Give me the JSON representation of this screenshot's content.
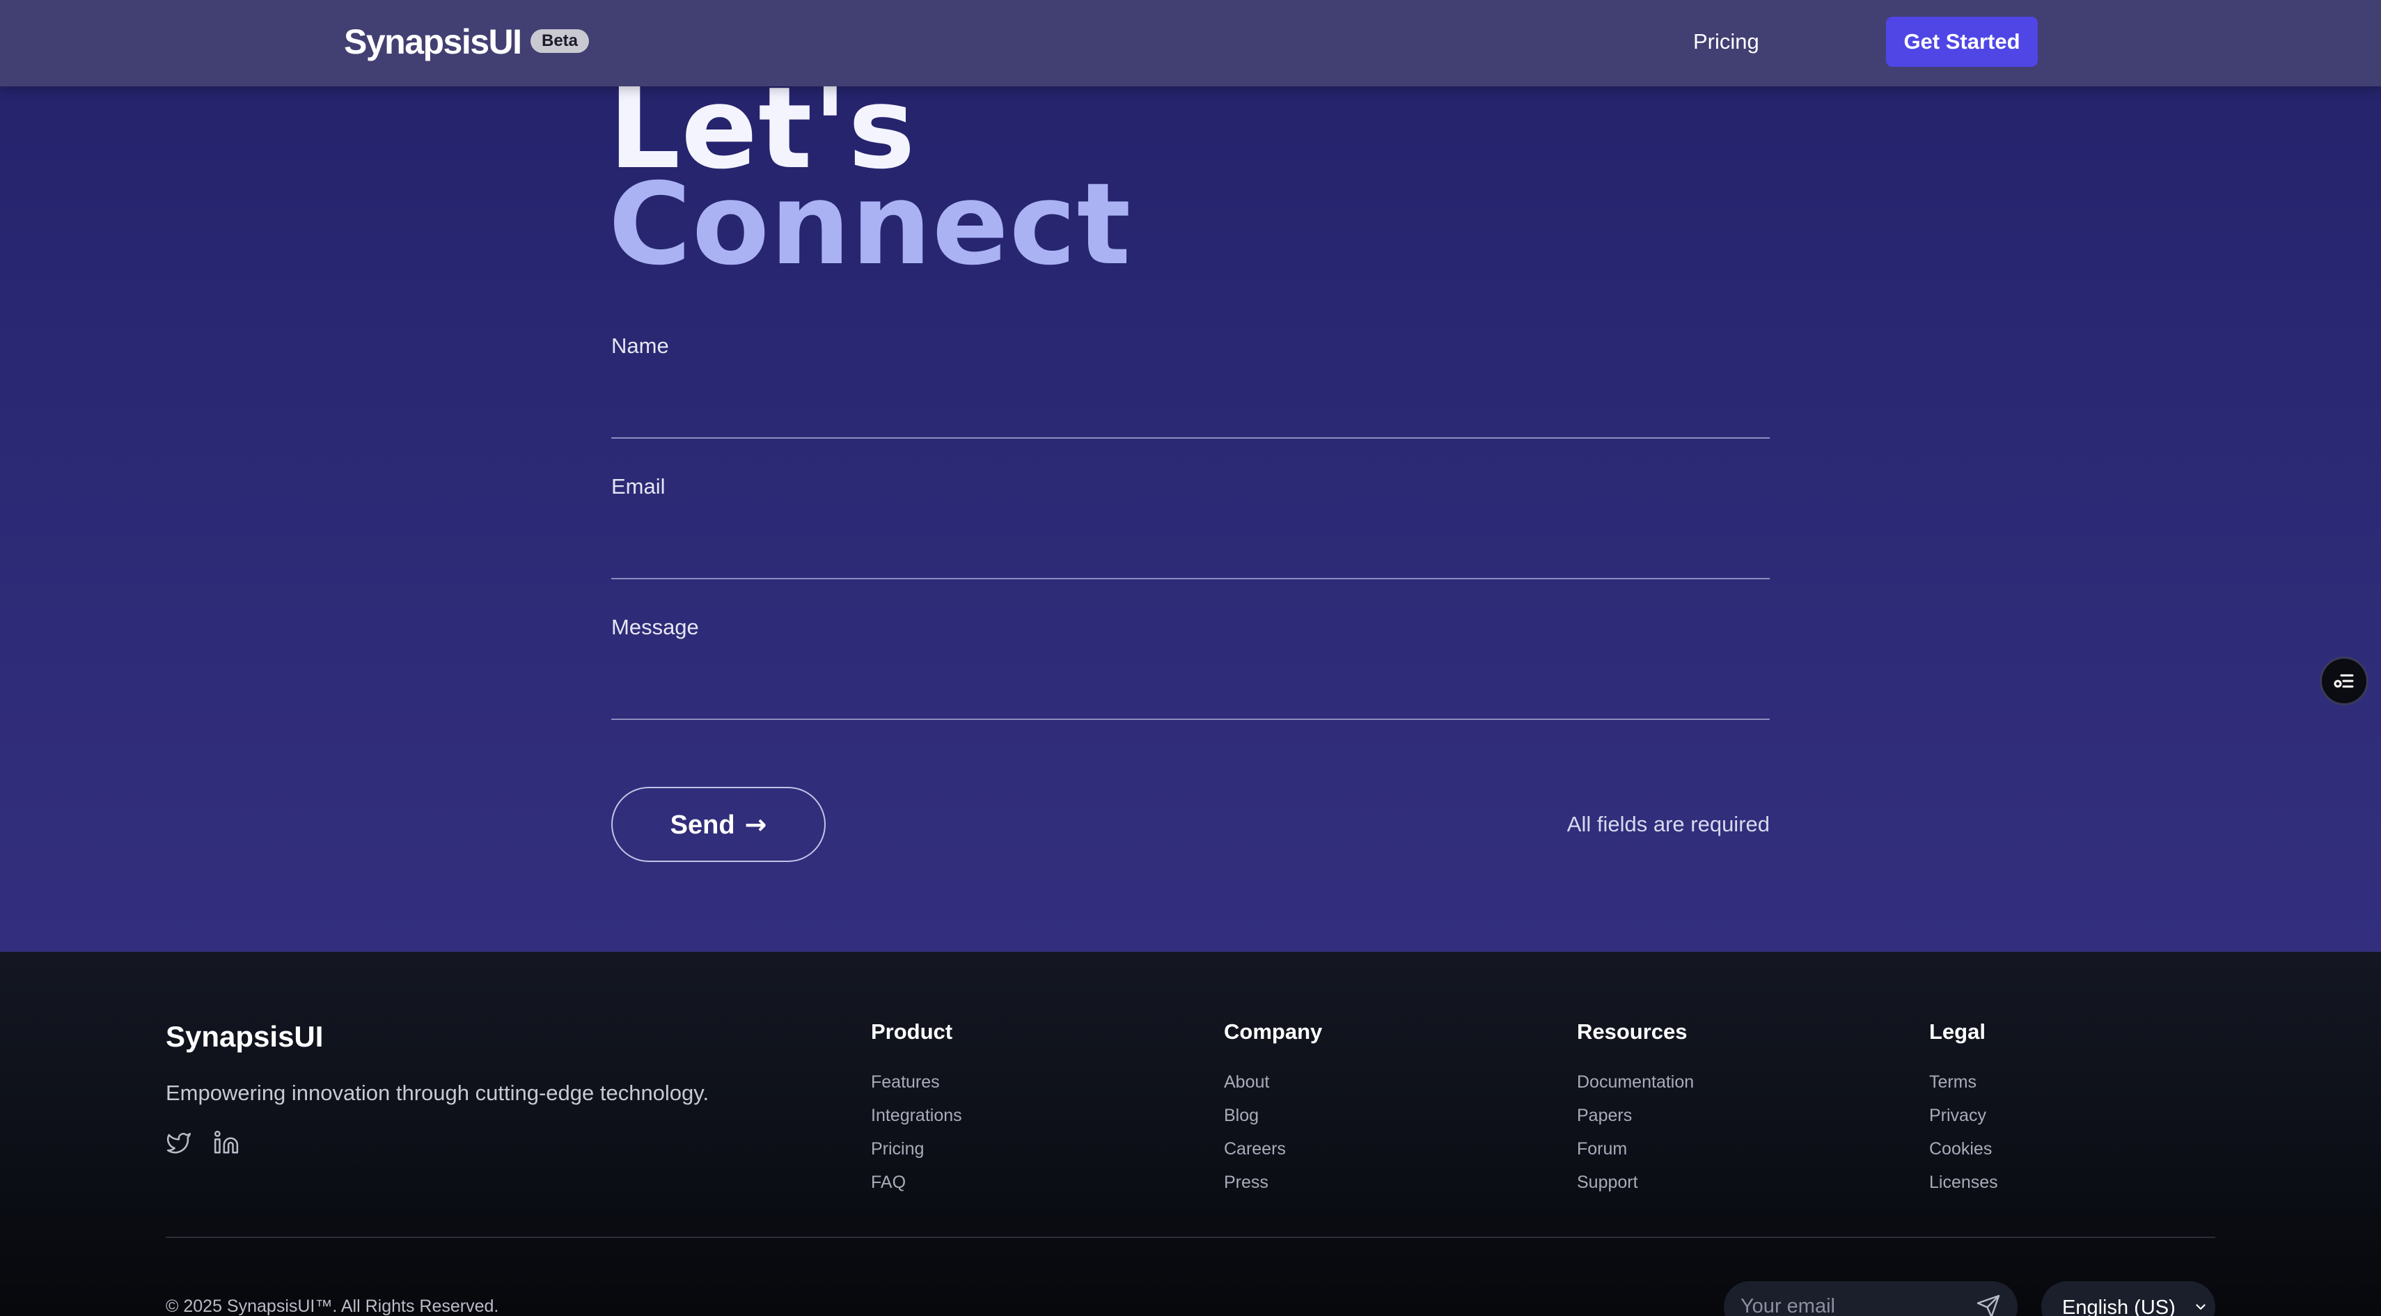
{
  "header": {
    "brand": "SynapsisUI",
    "badge": "Beta",
    "nav_pricing": "Pricing",
    "cta": "Get Started"
  },
  "hero": {
    "title_line1": "Let's",
    "title_line2": "Connect"
  },
  "form": {
    "name_label": "Name",
    "email_label": "Email",
    "message_label": "Message",
    "name_value": "",
    "email_value": "",
    "message_value": "",
    "send_label": "Send",
    "send_arrow": "→",
    "required_note": "All fields are required"
  },
  "footer": {
    "brand": "SynapsisUI",
    "tagline": "Empowering innovation through cutting-edge technology.",
    "social": [
      "twitter-icon",
      "linkedin-icon"
    ],
    "columns": [
      {
        "title": "Product",
        "links": [
          "Features",
          "Integrations",
          "Pricing",
          "FAQ"
        ]
      },
      {
        "title": "Company",
        "links": [
          "About",
          "Blog",
          "Careers",
          "Press"
        ]
      },
      {
        "title": "Resources",
        "links": [
          "Documentation",
          "Papers",
          "Forum",
          "Support"
        ]
      },
      {
        "title": "Legal",
        "links": [
          "Terms",
          "Privacy",
          "Cookies",
          "Licenses"
        ]
      }
    ],
    "copyright": "© 2025 SynapsisUI™. All Rights Reserved.",
    "newsletter_placeholder": "Your email",
    "language": "English (US)"
  },
  "colors": {
    "accent": "#4f46e5",
    "header_bg": "#423f72",
    "hero_bg": "#2b2974",
    "heading_highlight": "#aab2f4",
    "footer_bg": "#0d1018"
  }
}
